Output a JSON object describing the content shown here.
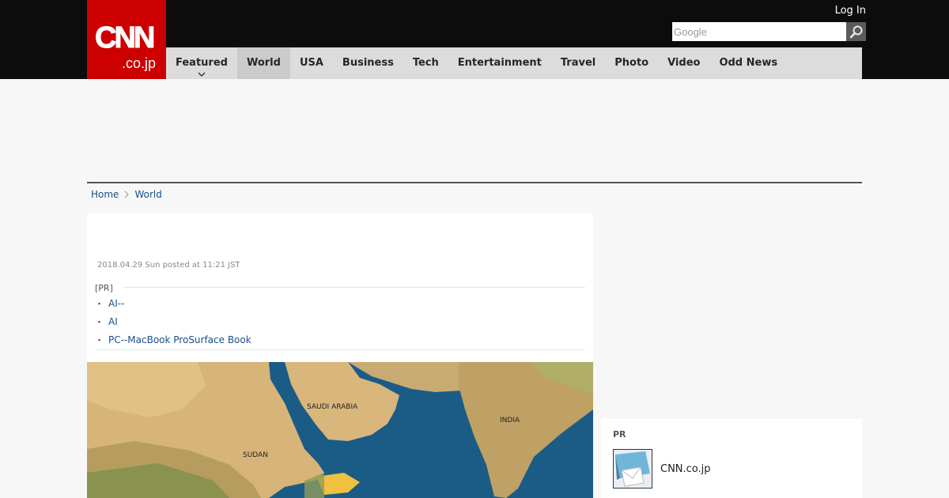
{
  "header": {
    "logo_text": "CNN",
    "logo_sub": ".co.jp",
    "login_label": "Log In",
    "search": {
      "placeholder": "Google",
      "value": ""
    },
    "search_icon": "magnifier-icon"
  },
  "nav": {
    "items": [
      {
        "label": "Featured"
      },
      {
        "label": "World"
      },
      {
        "label": "USA"
      },
      {
        "label": "Business"
      },
      {
        "label": "Tech"
      },
      {
        "label": "Entertainment"
      },
      {
        "label": "Travel"
      },
      {
        "label": "Photo"
      },
      {
        "label": "Video"
      },
      {
        "label": "Odd News"
      }
    ]
  },
  "breadcrumb": {
    "home": "Home",
    "current": "World"
  },
  "article": {
    "date": "2018.04.29 Sun posted at 11:21 JST",
    "pr_label": "[PR]",
    "pr_links": [
      {
        "label": "AI--"
      },
      {
        "label": "AI"
      },
      {
        "label": "PC--MacBook ProSurface Book"
      }
    ],
    "map_labels": {
      "saudi": "SAUDI ARABIA",
      "india": "INDIA",
      "sudan": "SUDAN"
    }
  },
  "sidebar": {
    "pr_label": "PR",
    "pr_item": "CNN.co.jp"
  },
  "colors": {
    "brand_red": "#cc0000",
    "header_bg": "#0c0c0c",
    "nav_bg": "#dcdcdc",
    "link_blue": "#1a4f8a"
  }
}
